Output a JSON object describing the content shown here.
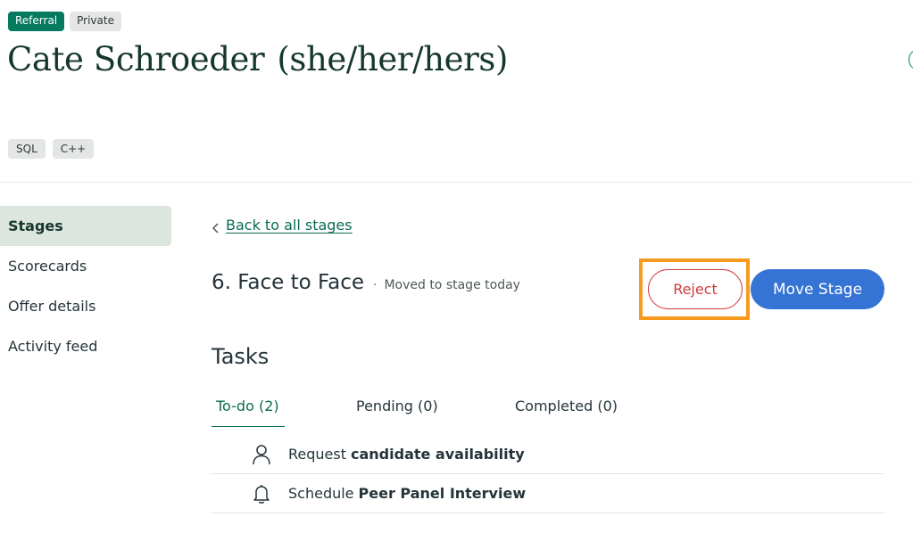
{
  "candidate": {
    "badges": [
      "Referral",
      "Private"
    ],
    "name": "Cate Schroeder",
    "pronouns": "(she/her/hers)",
    "tags": [
      "SQL",
      "C++"
    ]
  },
  "sidebar": {
    "items": [
      {
        "label": "Stages",
        "active": true
      },
      {
        "label": "Scorecards",
        "active": false
      },
      {
        "label": "Offer details",
        "active": false
      },
      {
        "label": "Activity feed",
        "active": false
      }
    ]
  },
  "stage": {
    "back_label": "Back to all stages",
    "title": "6. Face to Face",
    "separator": "·",
    "moved": "Moved to stage today",
    "reject_label": "Reject",
    "move_label": "Move Stage"
  },
  "tasks": {
    "heading": "Tasks",
    "tabs": [
      {
        "label": "To-do (2)",
        "active": true
      },
      {
        "label": "Pending (0)",
        "active": false
      },
      {
        "label": "Completed (0)",
        "active": false
      }
    ],
    "items": [
      {
        "icon": "person-icon",
        "prefix": "Request",
        "bold": "candidate availability"
      },
      {
        "icon": "bell-icon",
        "prefix": "Schedule",
        "bold": "Peer Panel Interview"
      }
    ]
  },
  "colors": {
    "brand_green": "#047a5e",
    "reject_red": "#d23b3b",
    "primary_blue": "#3574d4",
    "highlight_orange": "#f79a1e"
  }
}
